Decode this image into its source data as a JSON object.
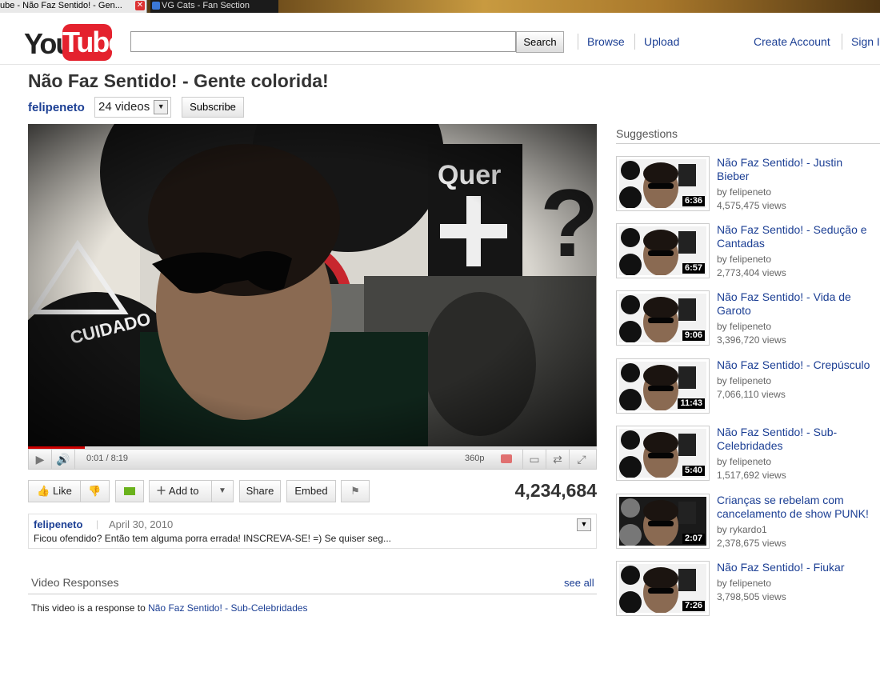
{
  "browser": {
    "tabs": [
      {
        "label": "ube - Não Faz Sentido! - Gen...",
        "close": "✕"
      },
      {
        "label": "VG Cats - Fan Section"
      }
    ]
  },
  "header": {
    "logo": {
      "you": "You",
      "tube": "Tube"
    },
    "search": {
      "value": "",
      "placeholder": "",
      "button_label": "Search"
    },
    "links": {
      "browse": "Browse",
      "upload": "Upload",
      "create_account": "Create Account",
      "sign_in": "Sign I"
    }
  },
  "video": {
    "title": "Não Faz Sentido! - Gente colorida!",
    "channel": "felipeneto",
    "videos_count": "24 videos",
    "subscribe_label": "Subscribe",
    "time": "0:01 / 8:19",
    "quality": "360p",
    "progress": 0.1,
    "view_count": "4,234,684"
  },
  "actions": {
    "like": "Like",
    "add_to": "Add to",
    "share": "Share",
    "embed": "Embed"
  },
  "description": {
    "author": "felipeneto",
    "separator": "|",
    "date": "April 30, 2010",
    "text": "Ficou ofendido? Então tem alguma porra errada! INSCREVA-SE! =) Se quiser seg..."
  },
  "video_responses": {
    "title": "Video Responses",
    "see_all": "see all",
    "text": "This video is a response to",
    "link": "Não Faz Sentido! - Sub-Celebridades"
  },
  "suggestions": {
    "title": "Suggestions",
    "items": [
      {
        "title": "Não Faz Sentido! - Justin Bieber",
        "by": "by felipeneto",
        "views": "4,575,475 views",
        "duration": "6:36"
      },
      {
        "title": "Não Faz Sentido! - Sedução e Cantadas",
        "by": "by felipeneto",
        "views": "2,773,404 views",
        "duration": "6:57"
      },
      {
        "title": "Não Faz Sentido! - Vida de Garoto",
        "by": "by felipeneto",
        "views": "3,396,720 views",
        "duration": "9:06"
      },
      {
        "title": "Não Faz Sentido! - Crepúsculo",
        "by": "by felipeneto",
        "views": "7,066,110 views",
        "duration": "11:43"
      },
      {
        "title": "Não Faz Sentido! - Sub-Celebridades",
        "by": "by felipeneto",
        "views": "1,517,692 views",
        "duration": "5:40"
      },
      {
        "title": "Crianças se rebelam com cancelamento de show PUNK!",
        "by": "by rykardo1",
        "views": "2,378,675 views",
        "duration": "2:07"
      },
      {
        "title": "Não Faz Sentido! - Fiukar",
        "by": "by felipeneto",
        "views": "3,798,505 views",
        "duration": "7:26"
      }
    ]
  },
  "icons": {
    "play": "play-icon",
    "volume": "volume-icon",
    "popout": "popout-icon",
    "expand": "expand-icon",
    "fullscreen": "fullscreen-icon",
    "thumbs_up": "thumbs-up-icon",
    "thumbs_down": "thumbs-down-icon",
    "flag": "flag-icon",
    "plus": "plus-icon",
    "dropdown": "chevron-down-icon"
  },
  "colors": {
    "link": "#1c3f94",
    "brand_red": "#e4222e"
  }
}
